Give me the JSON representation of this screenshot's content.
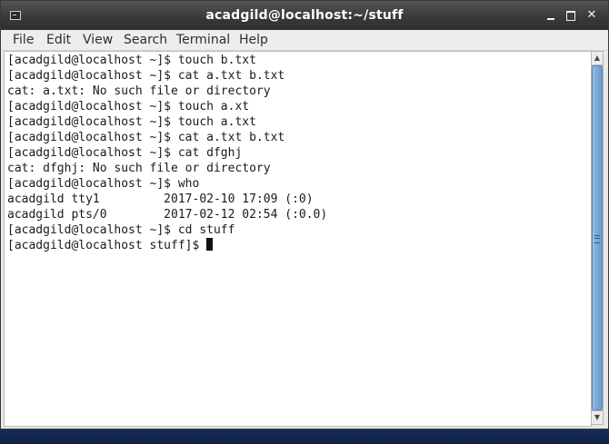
{
  "window": {
    "title": "acadgild@localhost:~/stuff"
  },
  "menubar": {
    "items": [
      "File",
      "Edit",
      "View",
      "Search",
      "Terminal",
      "Help"
    ]
  },
  "terminal": {
    "lines": [
      "[acadgild@localhost ~]$ touch b.txt",
      "[acadgild@localhost ~]$ cat a.txt b.txt",
      "cat: a.txt: No such file or directory",
      "[acadgild@localhost ~]$ touch a.xt",
      "[acadgild@localhost ~]$ touch a.txt",
      "[acadgild@localhost ~]$ cat a.txt b.txt",
      "[acadgild@localhost ~]$ cat dfghj",
      "cat: dfghj: No such file or directory",
      "[acadgild@localhost ~]$ who",
      "acadgild tty1         2017-02-10 17:09 (:0)",
      "acadgild pts/0        2017-02-12 02:54 (:0.0)",
      "[acadgild@localhost ~]$ cd stuff"
    ],
    "prompt": "[acadgild@localhost stuff]$ "
  },
  "icons": {
    "app": "terminal-icon",
    "minimize": "minimize-icon",
    "maximize": "maximize-icon",
    "close": "close-icon"
  }
}
